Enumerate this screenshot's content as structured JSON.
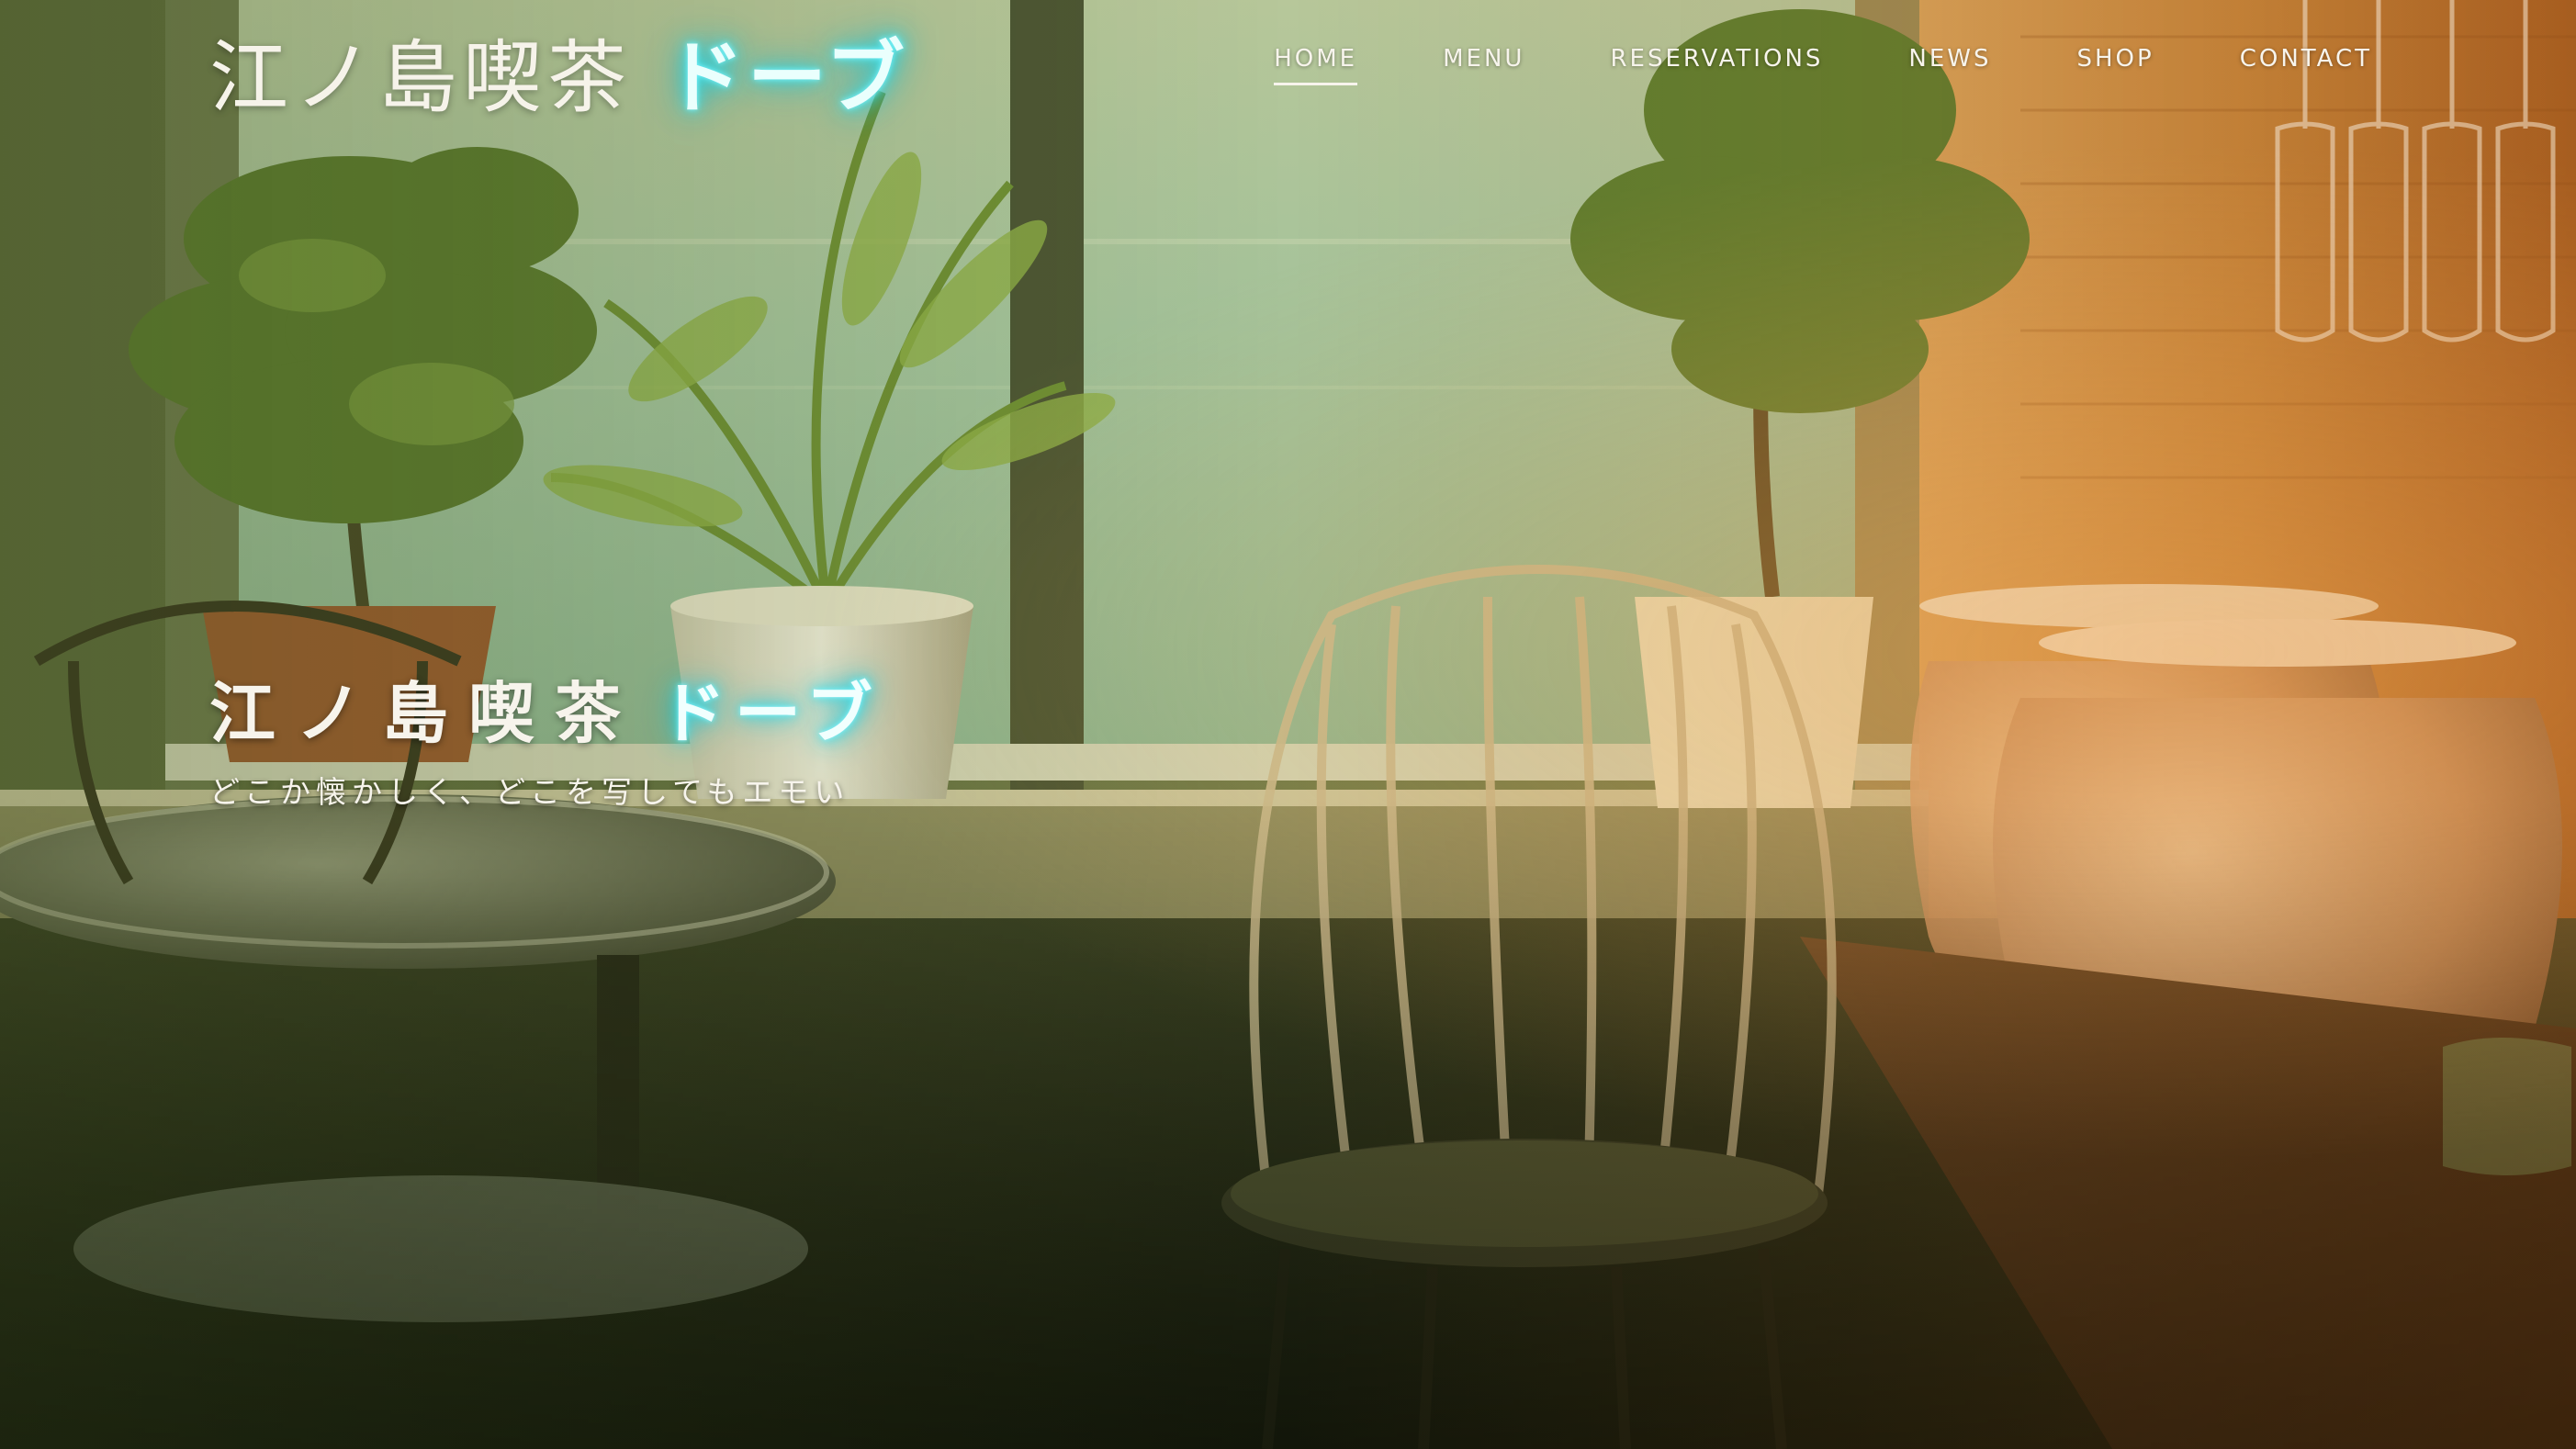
{
  "site": {
    "logo_text": "江ノ島喫茶",
    "logo_neon": "ドーブ",
    "accent_color": "#3fe3f0"
  },
  "nav": {
    "items": [
      {
        "label": "HOME",
        "active": true
      },
      {
        "label": "MENU",
        "active": false
      },
      {
        "label": "RESERVATIONS",
        "active": false
      },
      {
        "label": "NEWS",
        "active": false
      },
      {
        "label": "SHOP",
        "active": false
      },
      {
        "label": "CONTACT",
        "active": false
      }
    ]
  },
  "hero": {
    "title": "江ノ島喫茶",
    "title_neon": "ドーブ",
    "tagline": "どこか懐かしく、どこを写してもエモい",
    "background_image": "cafe-interior-window-sea-photo"
  }
}
